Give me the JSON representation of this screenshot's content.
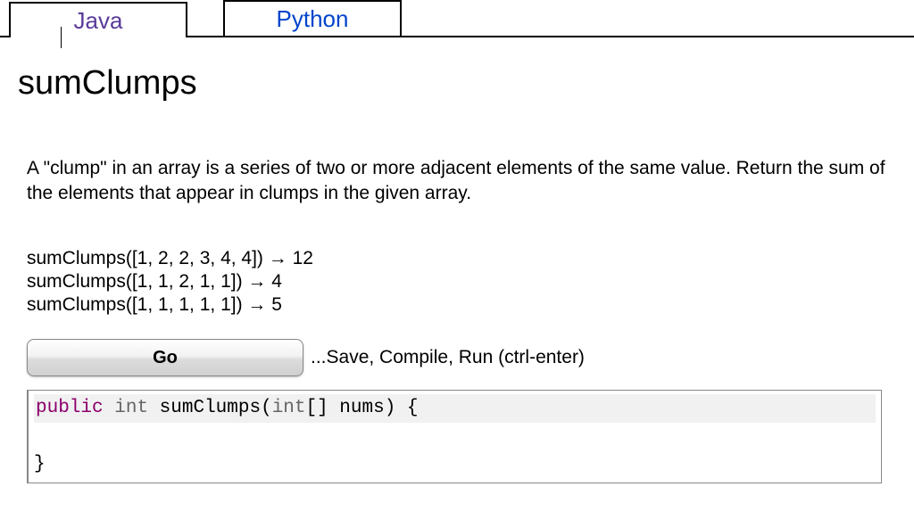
{
  "tabs": {
    "java": "Java",
    "python": "Python"
  },
  "problem": {
    "title": "sumClumps",
    "description": "A \"clump\" in an array is a series of two or more adjacent elements of the same value. Return the sum of the elements that appear in clumps in the given array.",
    "examples": [
      {
        "call": "sumClumps([1, 2, 2, 3, 4, 4])",
        "result": "12"
      },
      {
        "call": "sumClumps([1, 1, 2, 1, 1])",
        "result": "4"
      },
      {
        "call": "sumClumps([1, 1, 1, 1, 1])",
        "result": "5"
      }
    ],
    "arrow": " → "
  },
  "controls": {
    "go_label": "Go",
    "hint": "...Save, Compile, Run (ctrl-enter)"
  },
  "code": {
    "kw_public": "public",
    "kw_int1": "int",
    "fn_name": "sumClumps(",
    "kw_int2": "int",
    "params_tail": "[] nums) {",
    "close": "}"
  }
}
